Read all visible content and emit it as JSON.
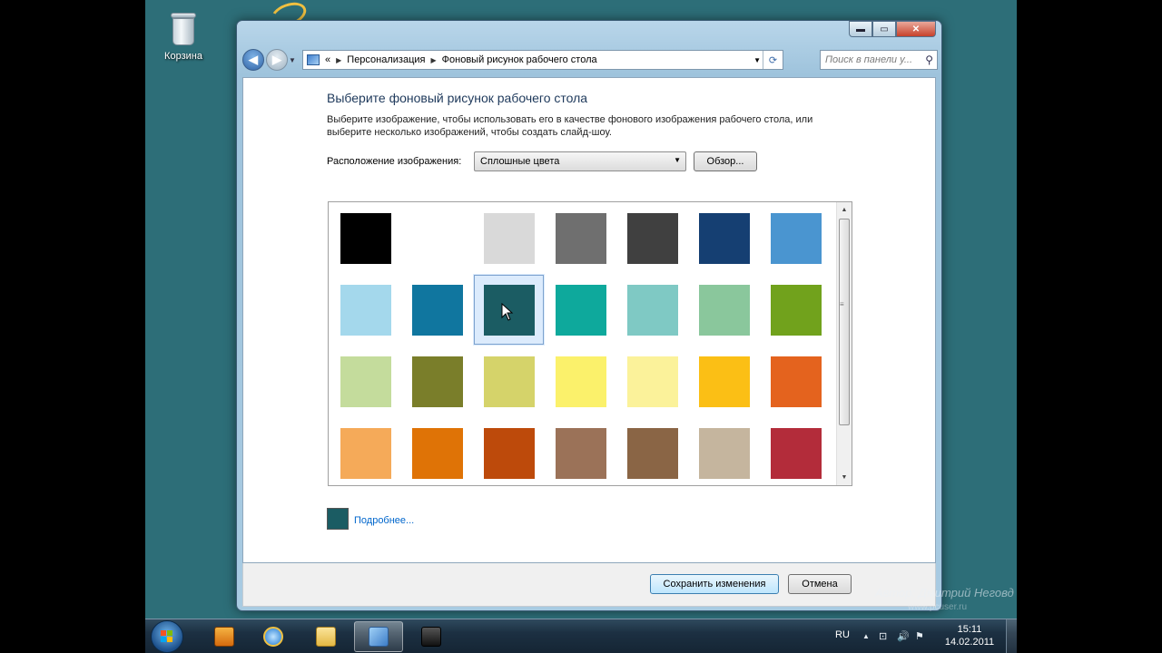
{
  "desktop": {
    "recycle_bin_label": "Корзина"
  },
  "window": {
    "caption_buttons": {
      "minimize": "▬",
      "maximize": "▭",
      "close": "✕"
    },
    "nav": {
      "back": "◀",
      "forward": "▶",
      "breadcrumb_root": "«",
      "crumb1": "Персонализация",
      "crumb2": "Фоновый рисунок рабочего стола",
      "dropdown_arrow": "▼",
      "refresh": "⟳"
    },
    "search": {
      "placeholder": "Поиск в панели у...",
      "icon": "⚲"
    }
  },
  "content": {
    "title": "Выберите фоновый рисунок рабочего стола",
    "description": "Выберите изображение, чтобы использовать его в качестве фонового изображения рабочего стола, или выберите несколько изображений, чтобы создать слайд-шоу.",
    "location_label": "Расположение изображения:",
    "location_value": "Сплошные цвета",
    "browse_button": "Обзор...",
    "more_link": "Подробнее...",
    "current_color": "#1b5c63",
    "selected_index": 9,
    "colors": [
      "#000000",
      "#ffffff",
      "#d9d9d9",
      "#6f6f6f",
      "#404040",
      "#153f72",
      "#4a95d0",
      "#a4d8ec",
      "#10769f",
      "#1b5c63",
      "#0ea99c",
      "#7fc9c4",
      "#8ac79c",
      "#71a21c",
      "#c4dc9c",
      "#7a7e2a",
      "#d5d36a",
      "#fbf16b",
      "#fbf29a",
      "#fbbf15",
      "#e4631e",
      "#f5aa59",
      "#df7306",
      "#bd4a0b",
      "#9b7258",
      "#8a6545",
      "#c5b59e",
      "#b32c3a"
    ]
  },
  "footer": {
    "save_button": "Сохранить изменения",
    "cancel_button": "Отмена"
  },
  "watermark": {
    "line1": "Автор: Дмитрий Неговд",
    "line2": "www.pcuser.ru"
  },
  "taskbar": {
    "language": "RU",
    "time": "15:11",
    "date": "14.02.2011",
    "tray_icons": {
      "up_arrow": "▲",
      "network": "⊡",
      "volume": "🔊",
      "flag": "⚑"
    }
  }
}
